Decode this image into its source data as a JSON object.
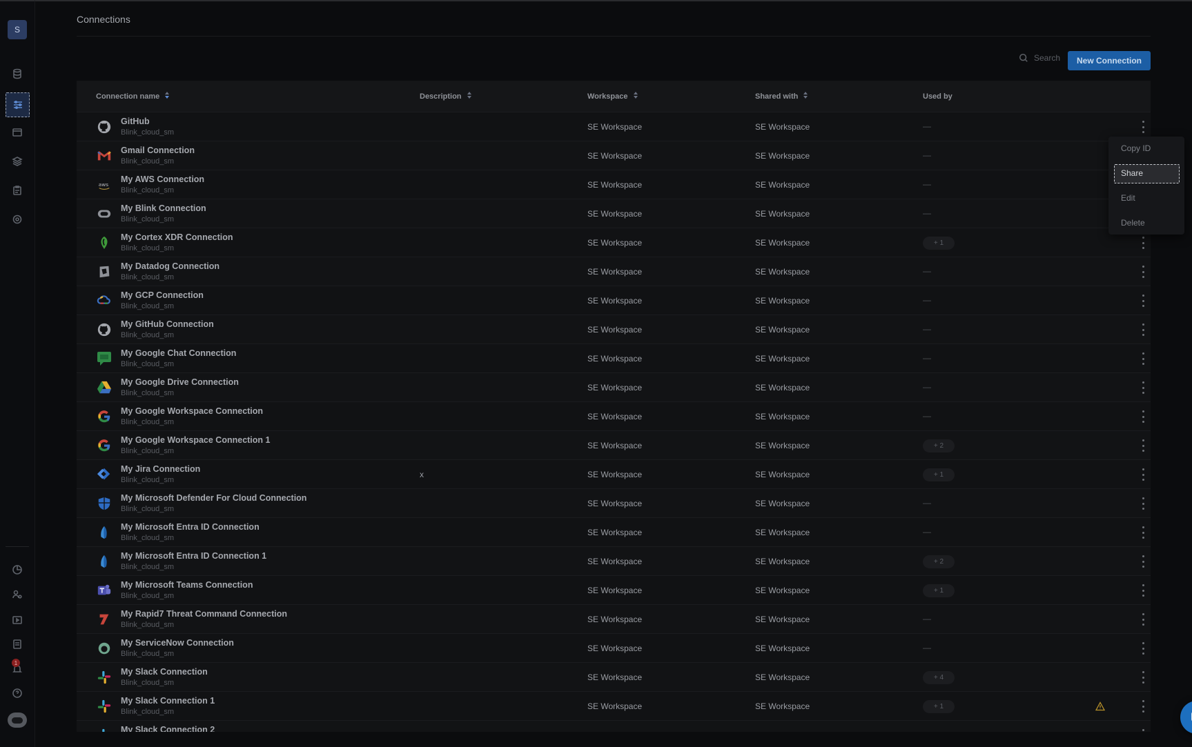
{
  "sidebar": {
    "avatar_initial": "S",
    "notification_count": "1"
  },
  "page": {
    "title": "Connections"
  },
  "toolbar": {
    "search_placeholder": "Search",
    "new_label": "New Connection"
  },
  "table": {
    "headers": {
      "name": "Connection name",
      "description": "Description",
      "workspace": "Workspace",
      "shared_with": "Shared with",
      "used_by": "Used by"
    },
    "rows": [
      {
        "name": "GitHub",
        "sub": "Blink_cloud_sm",
        "desc": "",
        "ws": "SE Workspace",
        "sw": "SE Workspace",
        "used": "—",
        "icon": "github-icon"
      },
      {
        "name": "Gmail Connection",
        "sub": "Blink_cloud_sm",
        "desc": "",
        "ws": "SE Workspace",
        "sw": "SE Workspace",
        "used": "—",
        "icon": "gmail-icon"
      },
      {
        "name": "My AWS Connection",
        "sub": "Blink_cloud_sm",
        "desc": "",
        "ws": "SE Workspace",
        "sw": "SE Workspace",
        "used": "—",
        "icon": "aws-icon"
      },
      {
        "name": "My Blink Connection",
        "sub": "Blink_cloud_sm",
        "desc": "",
        "ws": "SE Workspace",
        "sw": "SE Workspace",
        "used": "—",
        "icon": "blink-icon"
      },
      {
        "name": "My Cortex XDR Connection",
        "sub": "Blink_cloud_sm",
        "desc": "",
        "ws": "SE Workspace",
        "sw": "SE Workspace",
        "used": "+ 1",
        "icon": "cortex-icon"
      },
      {
        "name": "My Datadog Connection",
        "sub": "Blink_cloud_sm",
        "desc": "",
        "ws": "SE Workspace",
        "sw": "SE Workspace",
        "used": "—",
        "icon": "datadog-icon"
      },
      {
        "name": "My GCP Connection",
        "sub": "Blink_cloud_sm",
        "desc": "",
        "ws": "SE Workspace",
        "sw": "SE Workspace",
        "used": "—",
        "icon": "gcp-icon"
      },
      {
        "name": "My GitHub Connection",
        "sub": "Blink_cloud_sm",
        "desc": "",
        "ws": "SE Workspace",
        "sw": "SE Workspace",
        "used": "—",
        "icon": "github-icon"
      },
      {
        "name": "My Google Chat Connection",
        "sub": "Blink_cloud_sm",
        "desc": "",
        "ws": "SE Workspace",
        "sw": "SE Workspace",
        "used": "—",
        "icon": "google-chat-icon"
      },
      {
        "name": "My Google Drive Connection",
        "sub": "Blink_cloud_sm",
        "desc": "",
        "ws": "SE Workspace",
        "sw": "SE Workspace",
        "used": "—",
        "icon": "google-drive-icon"
      },
      {
        "name": "My Google Workspace Connection",
        "sub": "Blink_cloud_sm",
        "desc": "",
        "ws": "SE Workspace",
        "sw": "SE Workspace",
        "used": "—",
        "icon": "google-icon"
      },
      {
        "name": "My Google Workspace Connection 1",
        "sub": "Blink_cloud_sm",
        "desc": "",
        "ws": "SE Workspace",
        "sw": "SE Workspace",
        "used": "+ 2",
        "icon": "google-icon"
      },
      {
        "name": "My Jira Connection",
        "sub": "Blink_cloud_sm",
        "desc": "x",
        "ws": "SE Workspace",
        "sw": "SE Workspace",
        "used": "+ 1",
        "icon": "jira-icon"
      },
      {
        "name": "My Microsoft Defender For Cloud Connection",
        "sub": "Blink_cloud_sm",
        "desc": "",
        "ws": "SE Workspace",
        "sw": "SE Workspace",
        "used": "—",
        "icon": "defender-icon"
      },
      {
        "name": "My Microsoft Entra ID Connection",
        "sub": "Blink_cloud_sm",
        "desc": "",
        "ws": "SE Workspace",
        "sw": "SE Workspace",
        "used": "—",
        "icon": "entra-icon"
      },
      {
        "name": "My Microsoft Entra ID Connection 1",
        "sub": "Blink_cloud_sm",
        "desc": "",
        "ws": "SE Workspace",
        "sw": "SE Workspace",
        "used": "+ 2",
        "icon": "entra-icon"
      },
      {
        "name": "My Microsoft Teams Connection",
        "sub": "Blink_cloud_sm",
        "desc": "",
        "ws": "SE Workspace",
        "sw": "SE Workspace",
        "used": "+ 1",
        "icon": "teams-icon"
      },
      {
        "name": "My Rapid7 Threat Command Connection",
        "sub": "Blink_cloud_sm",
        "desc": "",
        "ws": "SE Workspace",
        "sw": "SE Workspace",
        "used": "—",
        "icon": "rapid7-icon"
      },
      {
        "name": "My ServiceNow Connection",
        "sub": "Blink_cloud_sm",
        "desc": "",
        "ws": "SE Workspace",
        "sw": "SE Workspace",
        "used": "—",
        "icon": "servicenow-icon"
      },
      {
        "name": "My Slack Connection",
        "sub": "Blink_cloud_sm",
        "desc": "",
        "ws": "SE Workspace",
        "sw": "SE Workspace",
        "used": "+ 4",
        "icon": "slack-icon"
      },
      {
        "name": "My Slack Connection 1",
        "sub": "Blink_cloud_sm",
        "desc": "",
        "ws": "SE Workspace",
        "sw": "SE Workspace",
        "used": "+ 1",
        "icon": "slack-icon",
        "warning": true
      },
      {
        "name": "My Slack Connection 2",
        "sub": "",
        "desc": "",
        "ws": "",
        "sw": "",
        "used": "",
        "icon": "slack-icon"
      }
    ]
  },
  "context_menu": {
    "copy_id": "Copy ID",
    "share": "Share",
    "edit": "Edit",
    "delete": "Delete"
  },
  "colors": {
    "accent": "#1c5ea5",
    "background": "#0b0c0e",
    "row": "#111214"
  }
}
